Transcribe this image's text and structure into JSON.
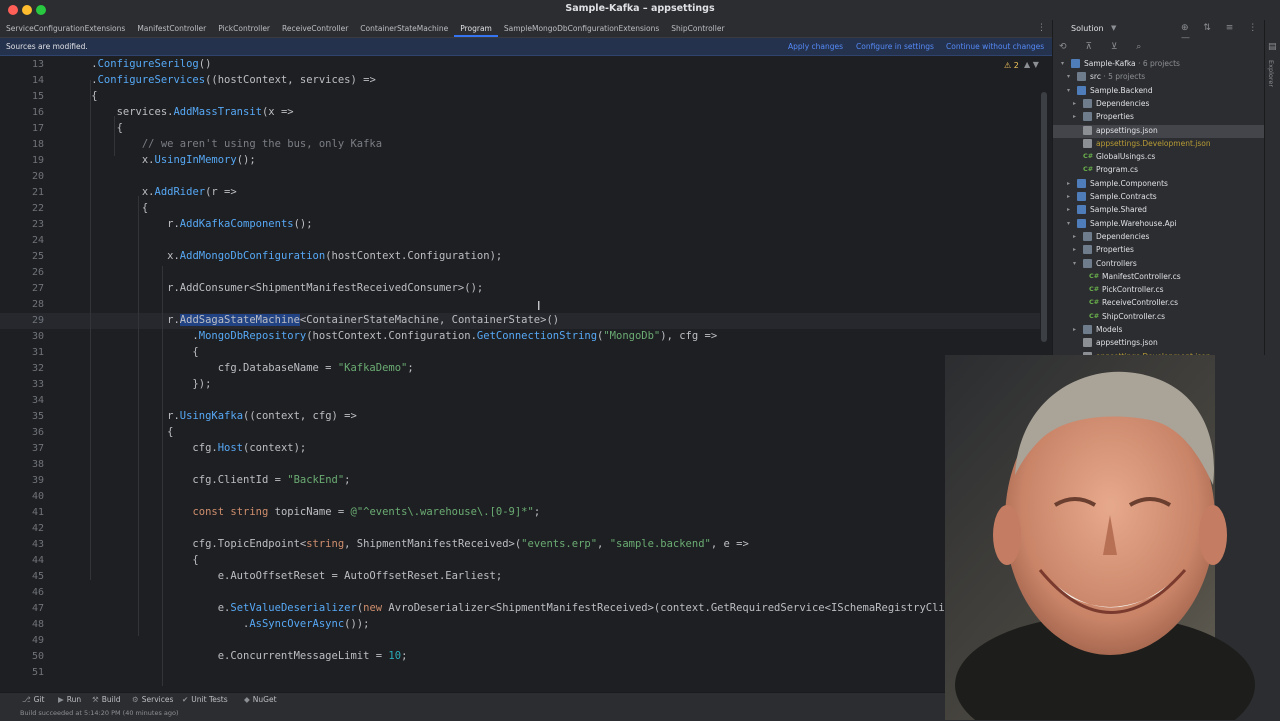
{
  "window": {
    "title": "Sample-Kafka – appsettings"
  },
  "tabs": [
    {
      "label": "ServiceConfigurationExtensions",
      "active": false
    },
    {
      "label": "ManifestController",
      "active": false
    },
    {
      "label": "PickController",
      "active": false
    },
    {
      "label": "ReceiveController",
      "active": false
    },
    {
      "label": "ContainerStateMachine",
      "active": false
    },
    {
      "label": "Program",
      "active": true
    },
    {
      "label": "SampleMongoDbConfigurationExtensions",
      "active": false
    },
    {
      "label": "ShipController",
      "active": false
    }
  ],
  "tabs_more": "⋮",
  "notification": {
    "text": "Sources are modified.",
    "apply": "Apply changes",
    "configure": "Configure in settings",
    "continue": "Continue without changes"
  },
  "editor": {
    "warning_count": "⚠ 2",
    "lines": [
      {
        "n": "13",
        "code": "    .ConfigureSerilog()"
      },
      {
        "n": "14",
        "code": "    .ConfigureServices((hostContext, services) =>"
      },
      {
        "n": "15",
        "code": "    {"
      },
      {
        "n": "16",
        "code": "        services.AddMassTransit(x =>"
      },
      {
        "n": "17",
        "code": "        {"
      },
      {
        "n": "18",
        "code": "            // we aren't using the bus, only Kafka"
      },
      {
        "n": "19",
        "code": "            x.UsingInMemory();"
      },
      {
        "n": "20",
        "code": ""
      },
      {
        "n": "21",
        "code": "            x.AddRider(r =>"
      },
      {
        "n": "22",
        "code": "            {"
      },
      {
        "n": "23",
        "code": "                r.AddKafkaComponents();"
      },
      {
        "n": "24",
        "code": ""
      },
      {
        "n": "25",
        "code": "                x.AddMongoDbConfiguration(hostContext.Configuration);"
      },
      {
        "n": "26",
        "code": ""
      },
      {
        "n": "27",
        "code": "                r.AddConsumer<ShipmentManifestReceivedConsumer>();"
      },
      {
        "n": "28",
        "code": ""
      },
      {
        "n": "29",
        "code": "                r.AddSagaStateMachine<ContainerStateMachine, ContainerState>()"
      },
      {
        "n": "30",
        "code": "                    .MongoDbRepository(hostContext.Configuration.GetConnectionString(\"MongoDb\"), cfg =>"
      },
      {
        "n": "31",
        "code": "                    {"
      },
      {
        "n": "32",
        "code": "                        cfg.DatabaseName = \"KafkaDemo\";"
      },
      {
        "n": "33",
        "code": "                    });"
      },
      {
        "n": "34",
        "code": ""
      },
      {
        "n": "35",
        "code": "                r.UsingKafka((context, cfg) =>"
      },
      {
        "n": "36",
        "code": "                {"
      },
      {
        "n": "37",
        "code": "                    cfg.Host(context);"
      },
      {
        "n": "38",
        "code": ""
      },
      {
        "n": "39",
        "code": "                    cfg.ClientId = \"BackEnd\";"
      },
      {
        "n": "40",
        "code": ""
      },
      {
        "n": "41",
        "code": "                    const string topicName = @\"^events\\.warehouse\\.[0-9]*\";"
      },
      {
        "n": "42",
        "code": ""
      },
      {
        "n": "43",
        "code": "                    cfg.TopicEndpoint<string, ShipmentManifestReceived>(\"events.erp\", \"sample.backend\", e =>"
      },
      {
        "n": "44",
        "code": "                    {"
      },
      {
        "n": "45",
        "code": "                        e.AutoOffsetReset = AutoOffsetReset.Earliest;"
      },
      {
        "n": "46",
        "code": ""
      },
      {
        "n": "47",
        "code": "                        e.SetValueDeserializer(new AvroDeserializer<ShipmentManifestReceived>(context.GetRequiredService<ISchemaRegistryClient>())"
      },
      {
        "n": "48",
        "code": "                            .AsSyncOverAsync());"
      },
      {
        "n": "49",
        "code": ""
      },
      {
        "n": "50",
        "code": "                        e.ConcurrentMessageLimit = 10;"
      },
      {
        "n": "51",
        "code": ""
      }
    ]
  },
  "solution": {
    "title": "Solution",
    "tree": [
      {
        "label": "Sample-Kafka",
        "extra": "· 6 projects",
        "depth": 0,
        "arrow": "▾",
        "icon": "proj",
        "mod": false,
        "selected": false
      },
      {
        "label": "src",
        "extra": "· 5 projects",
        "depth": 1,
        "arrow": "▾",
        "icon": "folder",
        "mod": false,
        "selected": false
      },
      {
        "label": "Sample.Backend",
        "extra": "",
        "depth": 1,
        "arrow": "▾",
        "icon": "proj",
        "mod": false,
        "selected": false
      },
      {
        "label": "Dependencies",
        "extra": "",
        "depth": 2,
        "arrow": "▸",
        "icon": "folder",
        "mod": false,
        "selected": false
      },
      {
        "label": "Properties",
        "extra": "",
        "depth": 2,
        "arrow": "▸",
        "icon": "folder",
        "mod": false,
        "selected": false
      },
      {
        "label": "appsettings.json",
        "extra": "",
        "depth": 2,
        "arrow": "",
        "icon": "json",
        "mod": false,
        "selected": true
      },
      {
        "label": "appsettings.Development.json",
        "extra": "",
        "depth": 2,
        "arrow": "",
        "icon": "json",
        "mod": true,
        "selected": false
      },
      {
        "label": "GlobalUsings.cs",
        "extra": "",
        "depth": 2,
        "arrow": "",
        "icon": "cs",
        "mod": false,
        "selected": false
      },
      {
        "label": "Program.cs",
        "extra": "",
        "depth": 2,
        "arrow": "",
        "icon": "cs",
        "mod": false,
        "selected": false
      },
      {
        "label": "Sample.Components",
        "extra": "",
        "depth": 1,
        "arrow": "▸",
        "icon": "proj",
        "mod": false,
        "selected": false
      },
      {
        "label": "Sample.Contracts",
        "extra": "",
        "depth": 1,
        "arrow": "▸",
        "icon": "proj",
        "mod": false,
        "selected": false
      },
      {
        "label": "Sample.Shared",
        "extra": "",
        "depth": 1,
        "arrow": "▸",
        "icon": "proj",
        "mod": false,
        "selected": false
      },
      {
        "label": "Sample.Warehouse.Api",
        "extra": "",
        "depth": 1,
        "arrow": "▾",
        "icon": "proj",
        "mod": false,
        "selected": false
      },
      {
        "label": "Dependencies",
        "extra": "",
        "depth": 2,
        "arrow": "▸",
        "icon": "folder",
        "mod": false,
        "selected": false
      },
      {
        "label": "Properties",
        "extra": "",
        "depth": 2,
        "arrow": "▸",
        "icon": "folder",
        "mod": false,
        "selected": false
      },
      {
        "label": "Controllers",
        "extra": "",
        "depth": 2,
        "arrow": "▾",
        "icon": "folder",
        "mod": false,
        "selected": false
      },
      {
        "label": "ManifestController.cs",
        "extra": "",
        "depth": 3,
        "arrow": "",
        "icon": "cs",
        "mod": false,
        "selected": false
      },
      {
        "label": "PickController.cs",
        "extra": "",
        "depth": 3,
        "arrow": "",
        "icon": "cs",
        "mod": false,
        "selected": false
      },
      {
        "label": "ReceiveController.cs",
        "extra": "",
        "depth": 3,
        "arrow": "",
        "icon": "cs",
        "mod": false,
        "selected": false
      },
      {
        "label": "ShipController.cs",
        "extra": "",
        "depth": 3,
        "arrow": "",
        "icon": "cs",
        "mod": false,
        "selected": false
      },
      {
        "label": "Models",
        "extra": "",
        "depth": 2,
        "arrow": "▸",
        "icon": "folder",
        "mod": false,
        "selected": false
      },
      {
        "label": "appsettings.json",
        "extra": "",
        "depth": 2,
        "arrow": "",
        "icon": "json",
        "mod": false,
        "selected": false
      },
      {
        "label": "appsettings.Development.json",
        "extra": "",
        "depth": 2,
        "arrow": "",
        "icon": "json",
        "mod": true,
        "selected": false
      }
    ]
  },
  "right_toolbar": {
    "label": "Explorer"
  },
  "toolwindows": [
    {
      "label": "Git",
      "icon": "git-icon",
      "glyph": "⎇"
    },
    {
      "label": "Run",
      "icon": "run-icon",
      "glyph": "▶"
    },
    {
      "label": "Build",
      "icon": "build-icon",
      "glyph": "⚒"
    },
    {
      "label": "Services",
      "icon": "services-icon",
      "glyph": "⚙"
    },
    {
      "label": "Unit Tests",
      "icon": "unit-tests-icon",
      "glyph": "✔"
    },
    {
      "label": "NuGet",
      "icon": "nuget-icon",
      "glyph": "◆"
    }
  ],
  "status": {
    "text": "Build succeeded at 5:14:20 PM (40 minutes ago)"
  },
  "colors": {
    "accent": "#3574f0",
    "link": "#548af7",
    "editor_bg": "#1e1f22",
    "panel_bg": "#2b2d30",
    "selection": "#214283"
  }
}
